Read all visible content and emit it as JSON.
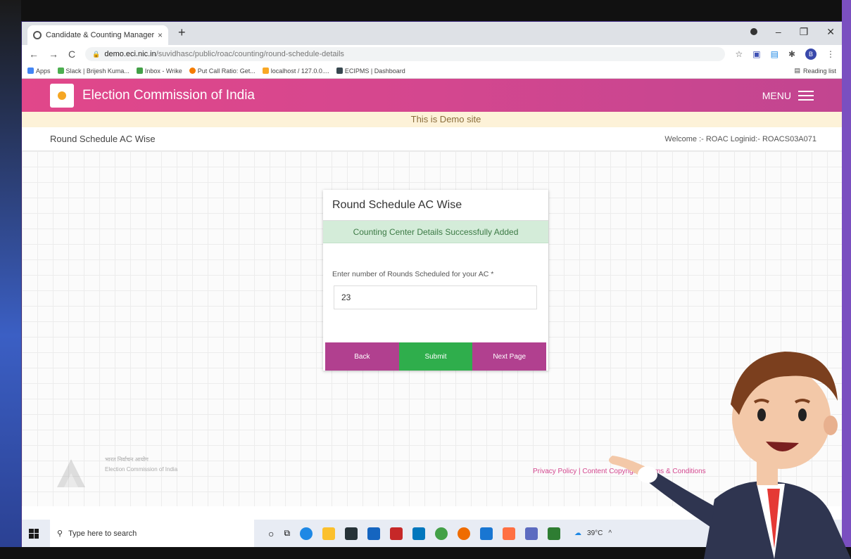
{
  "browser": {
    "tab_title": "Candidate & Counting Manager",
    "tab_close": "×",
    "new_tab": "+",
    "url_host": "demo.eci.nic.in",
    "url_path": "/suvidhasc/public/roac/counting/round-schedule-details",
    "bookmarks": [
      {
        "label": "Apps",
        "color": "#4285f4"
      },
      {
        "label": "Slack | Brijesh Kuma...",
        "color": "#4caf50"
      },
      {
        "label": "Inbox - Wrike",
        "color": "#43a047"
      },
      {
        "label": "Put Call Ratio: Get...",
        "color": "#f57c00"
      },
      {
        "label": "localhost / 127.0.0....",
        "color": "#f9a825"
      },
      {
        "label": "ECIPMS | Dashboard",
        "color": "#37474f"
      }
    ],
    "reading_list": "Reading list",
    "profile_initial": "B"
  },
  "header": {
    "brand": "Election Commission of India",
    "menu_label": "MENU"
  },
  "demo_banner": "This is Demo site",
  "subheader": {
    "title": "Round Schedule AC Wise",
    "welcome": "Welcome :- ROAC Loginid:- ROACS03A071"
  },
  "card": {
    "title": "Round Schedule AC Wise",
    "alert": "Counting Center Details Successfully Added",
    "field_label": "Enter number of Rounds Scheduled for your AC *",
    "field_value": "23",
    "buttons": {
      "back": "Back",
      "submit": "Submit",
      "next": "Next Page"
    }
  },
  "footer": {
    "org_hindi": "भारत निर्वाचन आयोग",
    "org_en": "Election Commission of India",
    "links": "Privacy Policy  |  Content Copyright  |  Terms & Conditions"
  },
  "taskbar": {
    "search_placeholder": "Type here to search",
    "temperature": "39°C"
  },
  "colors": {
    "header_pink": "#d4478f",
    "submit_green": "#2fae4c",
    "nav_button_magenta": "#b1408f",
    "alert_green_bg": "#d4ecd9"
  }
}
